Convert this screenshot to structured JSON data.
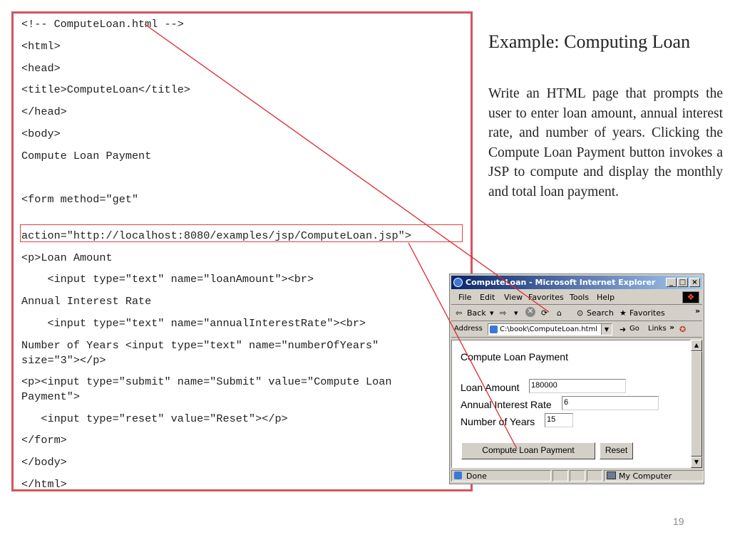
{
  "slide": {
    "title": "Example: Computing Loan",
    "description": "Write an HTML page that prompts the user to enter loan amount, annual interest rate, and number of years. Clicking the Compute Loan Payment button invokes a JSP to compute and display the monthly and total loan payment.",
    "page_number": "19"
  },
  "code": {
    "lines": [
      "<!-- ComputeLoan.html -->",
      "<html>",
      "<head>",
      "<title>ComputeLoan</title>",
      "</head>",
      "<body>",
      "Compute Loan Payment",
      "<form method=\"get\"",
      "action=\"http://localhost:8080/examples/jsp/ComputeLoan.jsp\">",
      "<p>Loan Amount",
      "    <input type=\"text\" name=\"loanAmount\"><br>",
      "Annual Interest Rate",
      "    <input type=\"text\" name=\"annualInterestRate\"><br>",
      "Number of Years <input type=\"text\" name=\"numberOfYears\"",
      "size=\"3\"></p>",
      "<p><input type=\"submit\" name=\"Submit\" value=\"Compute Loan",
      "Payment\">",
      "   <input type=\"reset\" value=\"Reset\"></p>",
      "</form>",
      "</body>",
      "</html>"
    ]
  },
  "browser": {
    "window_title": "ComputeLoan - Microsoft Internet Explorer",
    "menu": [
      "File",
      "Edit",
      "View",
      "Favorites",
      "Tools",
      "Help"
    ],
    "toolbar": {
      "back": "Back",
      "search": "Search",
      "favorites": "Favorites"
    },
    "address_label": "Address",
    "address_value": "C:\\book\\ComputeLoan.html",
    "go_label": "Go",
    "links_label": "Links",
    "content": {
      "heading": "Compute Loan Payment",
      "loan_amount_label": "Loan Amount",
      "loan_amount_value": "180000",
      "interest_label": "Annual Interest Rate",
      "interest_value": "6",
      "years_label": "Number of Years",
      "years_value": "15",
      "submit_label": "Compute Loan Payment",
      "reset_label": "Reset"
    },
    "status": {
      "done": "Done",
      "zone": "My Computer"
    }
  },
  "colors": {
    "frame": "#d0575e",
    "connector": "#e0282e"
  },
  "icons": [
    "ie-logo-icon",
    "minimize-icon",
    "maximize-icon",
    "close-icon",
    "windows-logo-icon",
    "back-arrow-icon",
    "forward-arrow-icon",
    "stop-icon",
    "refresh-icon",
    "home-icon",
    "search-icon",
    "favorites-icon",
    "page-icon",
    "go-arrow-icon",
    "computer-icon"
  ]
}
